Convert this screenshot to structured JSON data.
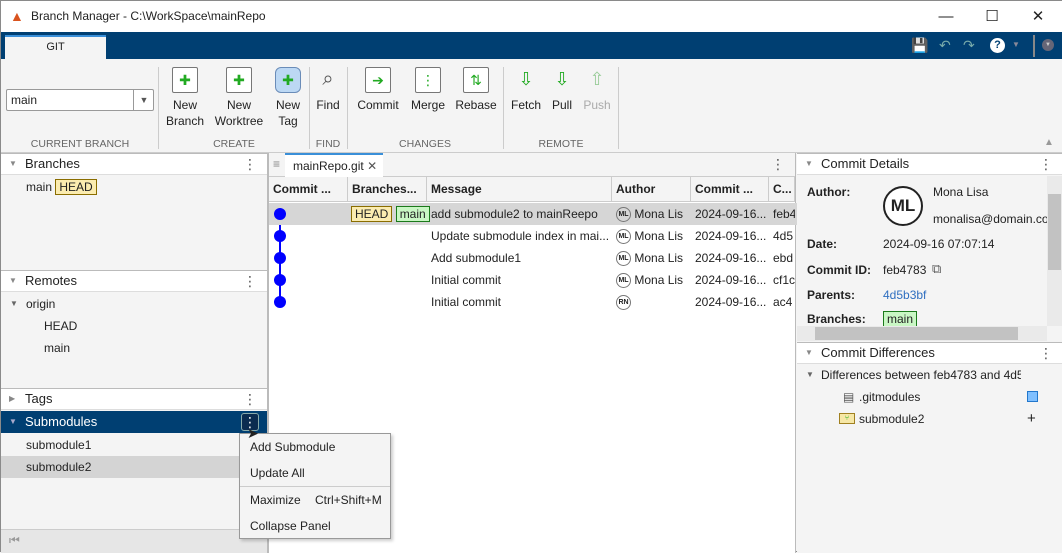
{
  "window": {
    "title": "Branch Manager - C:\\WorkSpace\\mainRepo"
  },
  "ribbon": {
    "tab": "GIT",
    "current_branch": {
      "value": "main",
      "group": "CURRENT BRANCH"
    },
    "groups": {
      "create": "CREATE",
      "find": "FIND",
      "changes": "CHANGES",
      "remote": "REMOTE"
    },
    "buttons": {
      "new_branch": [
        "New",
        "Branch"
      ],
      "new_worktree": [
        "New",
        "Worktree"
      ],
      "new_tag": [
        "New",
        "Tag"
      ],
      "find": "Find",
      "commit": "Commit",
      "merge": "Merge",
      "rebase": "Rebase",
      "fetch": "Fetch",
      "pull": "Pull",
      "push": "Push"
    }
  },
  "left": {
    "branches": {
      "title": "Branches",
      "items": [
        {
          "name": "main",
          "badge": "HEAD"
        }
      ]
    },
    "remotes": {
      "title": "Remotes",
      "origin": "origin",
      "children": [
        "HEAD",
        "main"
      ]
    },
    "tags": {
      "title": "Tags"
    },
    "submodules": {
      "title": "Submodules",
      "items": [
        "submodule1",
        "submodule2"
      ]
    }
  },
  "context_menu": {
    "items": [
      "Add Submodule",
      "Update All"
    ],
    "maximize": "Maximize",
    "maximize_shortcut": "Ctrl+Shift+M",
    "collapse": "Collapse Panel"
  },
  "center": {
    "tab": "mainRepo.git",
    "columns": [
      "Commit ...",
      "Branches...",
      "Message",
      "Author",
      "Commit ...",
      "C..."
    ],
    "rows": [
      {
        "badges": [
          "HEAD",
          "main"
        ],
        "message": "add submodule2 to mainReepo",
        "initials": "ML",
        "author": "Mona Lis",
        "date": "2024-09-16...",
        "id": "feb4"
      },
      {
        "message": "Update submodule index in mai...",
        "initials": "ML",
        "author": "Mona Lis",
        "date": "2024-09-16...",
        "id": "4d5"
      },
      {
        "message": "Add submodule1",
        "initials": "ML",
        "author": "Mona Lis",
        "date": "2024-09-16...",
        "id": "ebd"
      },
      {
        "message": "Initial commit",
        "initials": "ML",
        "author": "Mona Lis",
        "date": "2024-09-16...",
        "id": "cf1c"
      },
      {
        "message": "Initial commit",
        "initials": "RN",
        "author": "",
        "date": "2024-09-16...",
        "id": "ac4"
      }
    ]
  },
  "details": {
    "title": "Commit Details",
    "author_label": "Author:",
    "initials": "ML",
    "name": "Mona Lisa",
    "email": "monalisa@domain.co",
    "date_label": "Date:",
    "date": "2024-09-16 07:07:14",
    "id_label": "Commit ID:",
    "id": "feb4783",
    "parents_label": "Parents:",
    "parents": "4d5b3bf",
    "branches_label": "Branches:",
    "branch": "main"
  },
  "differences": {
    "title": "Commit Differences",
    "root": "Differences between feb4783 and 4d5",
    "files": [
      ".gitmodules",
      "submodule2"
    ]
  },
  "colors": {
    "accent": "#003f72",
    "graph": "#0000ff"
  }
}
